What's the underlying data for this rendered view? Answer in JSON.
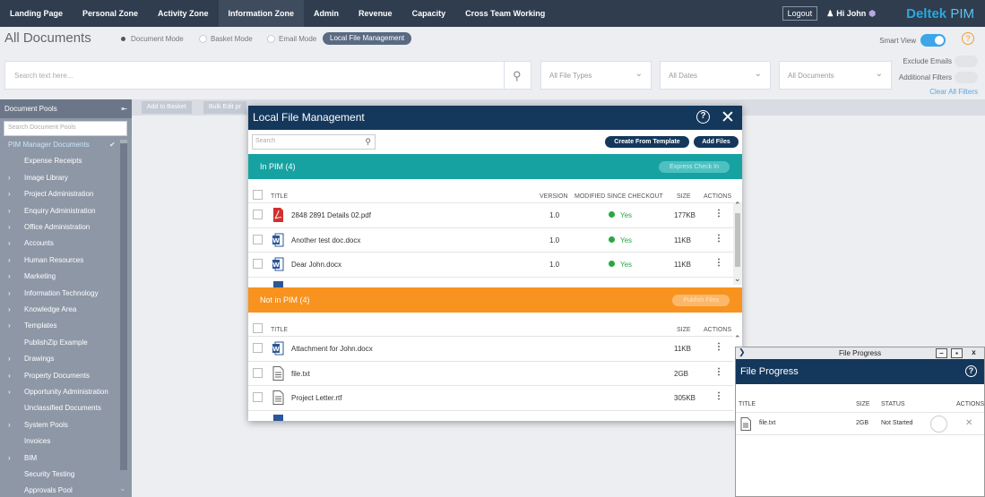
{
  "nav": {
    "items": [
      "Landing Page",
      "Personal Zone",
      "Activity Zone",
      "Information Zone",
      "Admin",
      "Revenue",
      "Capacity",
      "Cross Team Working"
    ],
    "active_index": 3,
    "logout": "Logout",
    "greeting": "Hi John",
    "brand": "Deltek",
    "brand_suffix": "PIM"
  },
  "header": {
    "title": "All Documents",
    "modes": [
      "Document Mode",
      "Basket Mode",
      "Email Mode",
      "Local File Management"
    ],
    "smart_view": "Smart View",
    "help": "?"
  },
  "search": {
    "placeholder": "Search text here...",
    "file_types": "All File Types",
    "dates": "All Dates",
    "documents": "All Documents",
    "exclude_emails": "Exclude Emails",
    "additional_filters": "Additional Filters",
    "clear_all": "Clear All Filters"
  },
  "toolbar": {
    "add_to_basket": "Add to Basket",
    "bulk_edit": "Bulk Edit pr"
  },
  "sidebar": {
    "title": "Document Pools",
    "search_placeholder": "Search Document Pools",
    "pools": [
      {
        "label": "PIM Manager Documents",
        "arrow": false,
        "selected": true
      },
      {
        "label": "Expense Receipts",
        "arrow": false
      },
      {
        "label": "Image Library",
        "arrow": true
      },
      {
        "label": "Project Administration",
        "arrow": true
      },
      {
        "label": "Enquiry Administration",
        "arrow": true
      },
      {
        "label": "Office Administration",
        "arrow": true
      },
      {
        "label": "Accounts",
        "arrow": true
      },
      {
        "label": "Human Resources",
        "arrow": true
      },
      {
        "label": "Marketing",
        "arrow": true
      },
      {
        "label": "Information Technology",
        "arrow": true
      },
      {
        "label": "Knowledge Area",
        "arrow": true
      },
      {
        "label": "Templates",
        "arrow": true
      },
      {
        "label": "PublishZip Example",
        "arrow": false
      },
      {
        "label": "Drawings",
        "arrow": true
      },
      {
        "label": "Property Documents",
        "arrow": true
      },
      {
        "label": "Opportunity Administration",
        "arrow": true
      },
      {
        "label": "Unclassified Documents",
        "arrow": false
      },
      {
        "label": "System Pools",
        "arrow": true
      },
      {
        "label": "Invoices",
        "arrow": false
      },
      {
        "label": "BIM",
        "arrow": true
      },
      {
        "label": "Security Testing",
        "arrow": false
      },
      {
        "label": "Approvals Pool",
        "arrow": false
      }
    ]
  },
  "modal": {
    "title": "Local File Management",
    "search_placeholder": "Search",
    "create_from_template": "Create From Template",
    "add_files": "Add Files",
    "in_pim": {
      "title": "In PIM (4)",
      "action": "Express Check In",
      "color": "#17a2a2",
      "columns": {
        "title": "TITLE",
        "version": "VERSION",
        "modified": "MODIFIED SINCE CHECKOUT",
        "size": "SIZE",
        "actions": "ACTIONS"
      },
      "rows": [
        {
          "name": "2848 2891 Details 02.pdf",
          "icon": "pdf-icon",
          "version": "1.0",
          "modified": "Yes",
          "size": "177KB"
        },
        {
          "name": "Another test doc.docx",
          "icon": "word-icon",
          "version": "1.0",
          "modified": "Yes",
          "size": "11KB"
        },
        {
          "name": "Dear John.docx",
          "icon": "word-icon",
          "version": "1.0",
          "modified": "Yes",
          "size": "11KB"
        }
      ]
    },
    "not_in_pim": {
      "title": "Not in PIM (4)",
      "action": "Publish Files",
      "color": "#f7931e",
      "columns": {
        "title": "TITLE",
        "size": "SIZE",
        "actions": "ACTIONS"
      },
      "rows": [
        {
          "name": "Attachment for John.docx",
          "icon": "word-icon",
          "size": "11KB"
        },
        {
          "name": "file.txt",
          "icon": "text-file-icon",
          "size": "2GB"
        },
        {
          "name": "Project Letter.rtf",
          "icon": "text-file-icon",
          "size": "305KB"
        }
      ]
    }
  },
  "file_progress": {
    "window_title": "File Progress",
    "title": "File Progress",
    "columns": {
      "title": "TITLE",
      "size": "SIZE",
      "status": "STATUS",
      "actions": "ACTIONS"
    },
    "rows": [
      {
        "name": "file.txt",
        "size": "2GB",
        "status": "Not Started"
      }
    ]
  },
  "colors": {
    "nav_bg": "#2f3d4f",
    "modal_header": "#14375c",
    "in_pim": "#17a2a2",
    "not_in_pim": "#f7931e",
    "sidebar": "#8e97a6"
  }
}
